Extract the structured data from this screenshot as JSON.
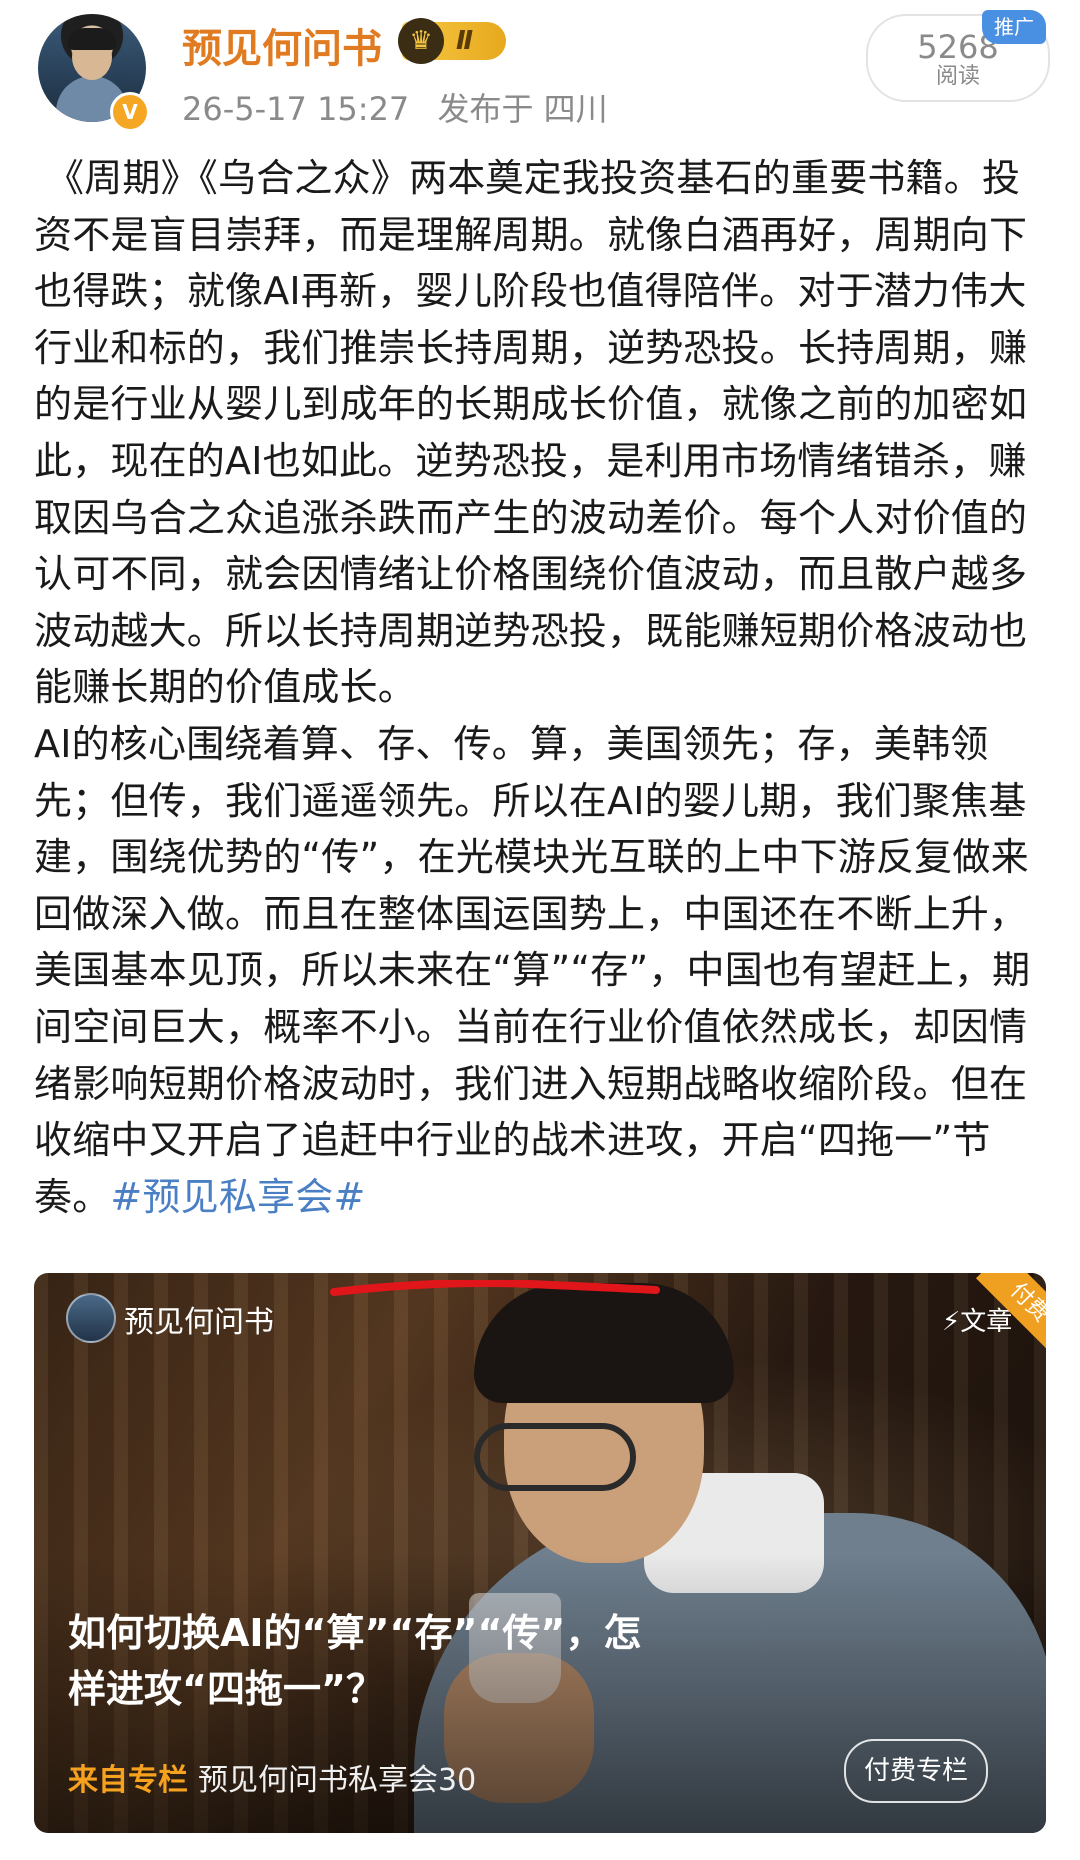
{
  "post": {
    "author": "预见何问书",
    "level_badge": "Ⅱ",
    "timestamp": "26-5-17 15:27",
    "location": "发布于 四川",
    "views_count": "5268",
    "views_label": "阅读",
    "promo_tag": "推广",
    "paragraphs": [
      "《周期》《乌合之众》两本奠定我投资基石的重要书籍。投资不是盲目崇拜，而是理解周期。就像白酒再好，周期向下也得跌；就像AI再新，婴儿阶段也值得陪伴。对于潜力伟大行业和标的，我们推崇长持周期，逆势恐投。长持周期，赚的是行业从婴儿到成年的长期成长价值，就像之前的加密如此，现在的AI也如此。逆势恐投，是利用市场情绪错杀，赚取因乌合之众追涨杀跌而产生的波动差价。每个人对价值的认可不同，就会因情绪让价格围绕价值波动，而且散户越多波动越大。所以长持周期逆势恐投，既能赚短期价格波动也能赚长期的价值成长。",
      "AI的核心围绕着算、存、传。算，美国领先；存，美韩领先；但传，我们遥遥领先。所以在AI的婴儿期，我们聚焦基建，围绕优势的“传”，在光模块光互联的上中下游反复做来回做深入做。而且在整体国运国势上，中国还在不断上升，美国基本见顶，所以未来在“算”“存”，中国也有望赶上，期间空间巨大，概率不小。当前在行业价值依然成长，却因情绪影响短期价格波动时，我们进入短期战略收缩阶段。但在收缩中又开启了追赶中行业的战术进攻，开启“四拖一”节奏。"
    ],
    "hashtag": "#预见私享会#"
  },
  "card": {
    "author": "预见何问书",
    "type_label": "文章",
    "paid_ribbon": "付费",
    "title": "如何切换AI的“算”“存”“传”，怎样进攻“四拖一”？",
    "source_label": "来自专栏",
    "source_name": "预见何问书私享会30",
    "paid_button": "付费专栏"
  },
  "colors": {
    "username": "#e07b22",
    "hashtag": "#4a7fc4",
    "promo": "#4a90e2",
    "source_label": "#f6a21e",
    "underline_mark": "#e0161b"
  },
  "icons": [
    "verified-v-icon",
    "crown-icon",
    "lightning-icon"
  ]
}
